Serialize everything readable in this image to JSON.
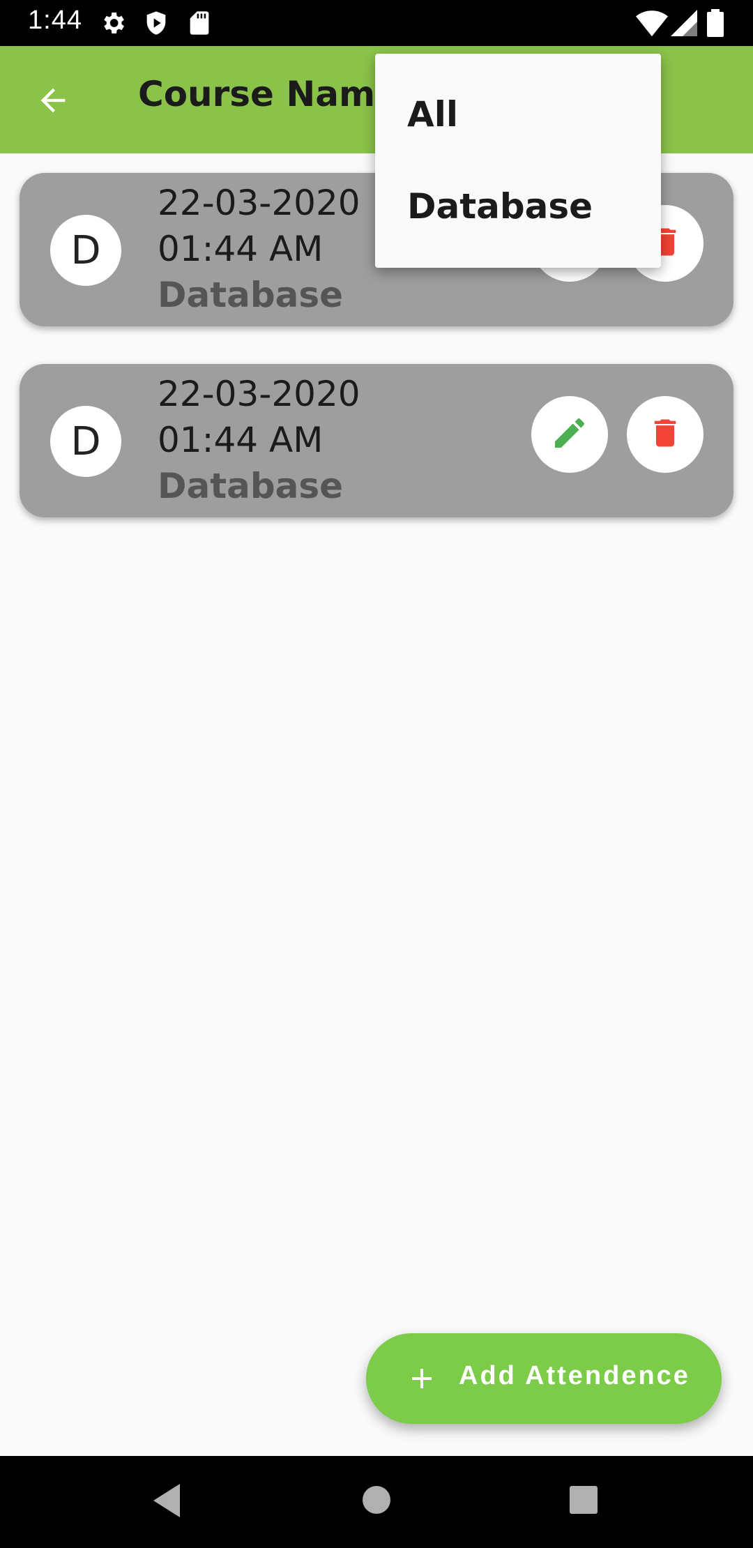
{
  "status_bar": {
    "time": "1:44",
    "icons": [
      "gear-icon",
      "play-shield-icon",
      "sd-card-icon",
      "wifi-icon",
      "signal-icon",
      "battery-icon"
    ]
  },
  "app_bar": {
    "title": "Course Name",
    "back_icon": "arrow-left-icon",
    "background": "#8bc34a"
  },
  "attendance_list": [
    {
      "avatar_letter": "D",
      "date": "22-03-2020",
      "time": "01:44 AM",
      "course": "Database"
    },
    {
      "avatar_letter": "D",
      "date": "22-03-2020",
      "time": "01:44 AM",
      "course": "Database"
    }
  ],
  "filter_menu": {
    "items": [
      "All",
      "Database"
    ]
  },
  "fab": {
    "label": "Add Attendence",
    "icon": "plus-icon",
    "background": "#7ccc4a"
  },
  "colors": {
    "card": "#9e9e9e",
    "edit": "#4caf50",
    "delete": "#f44336"
  },
  "nav_bar": {
    "icons": [
      "back-triangle-icon",
      "home-circle-icon",
      "recents-square-icon"
    ]
  }
}
